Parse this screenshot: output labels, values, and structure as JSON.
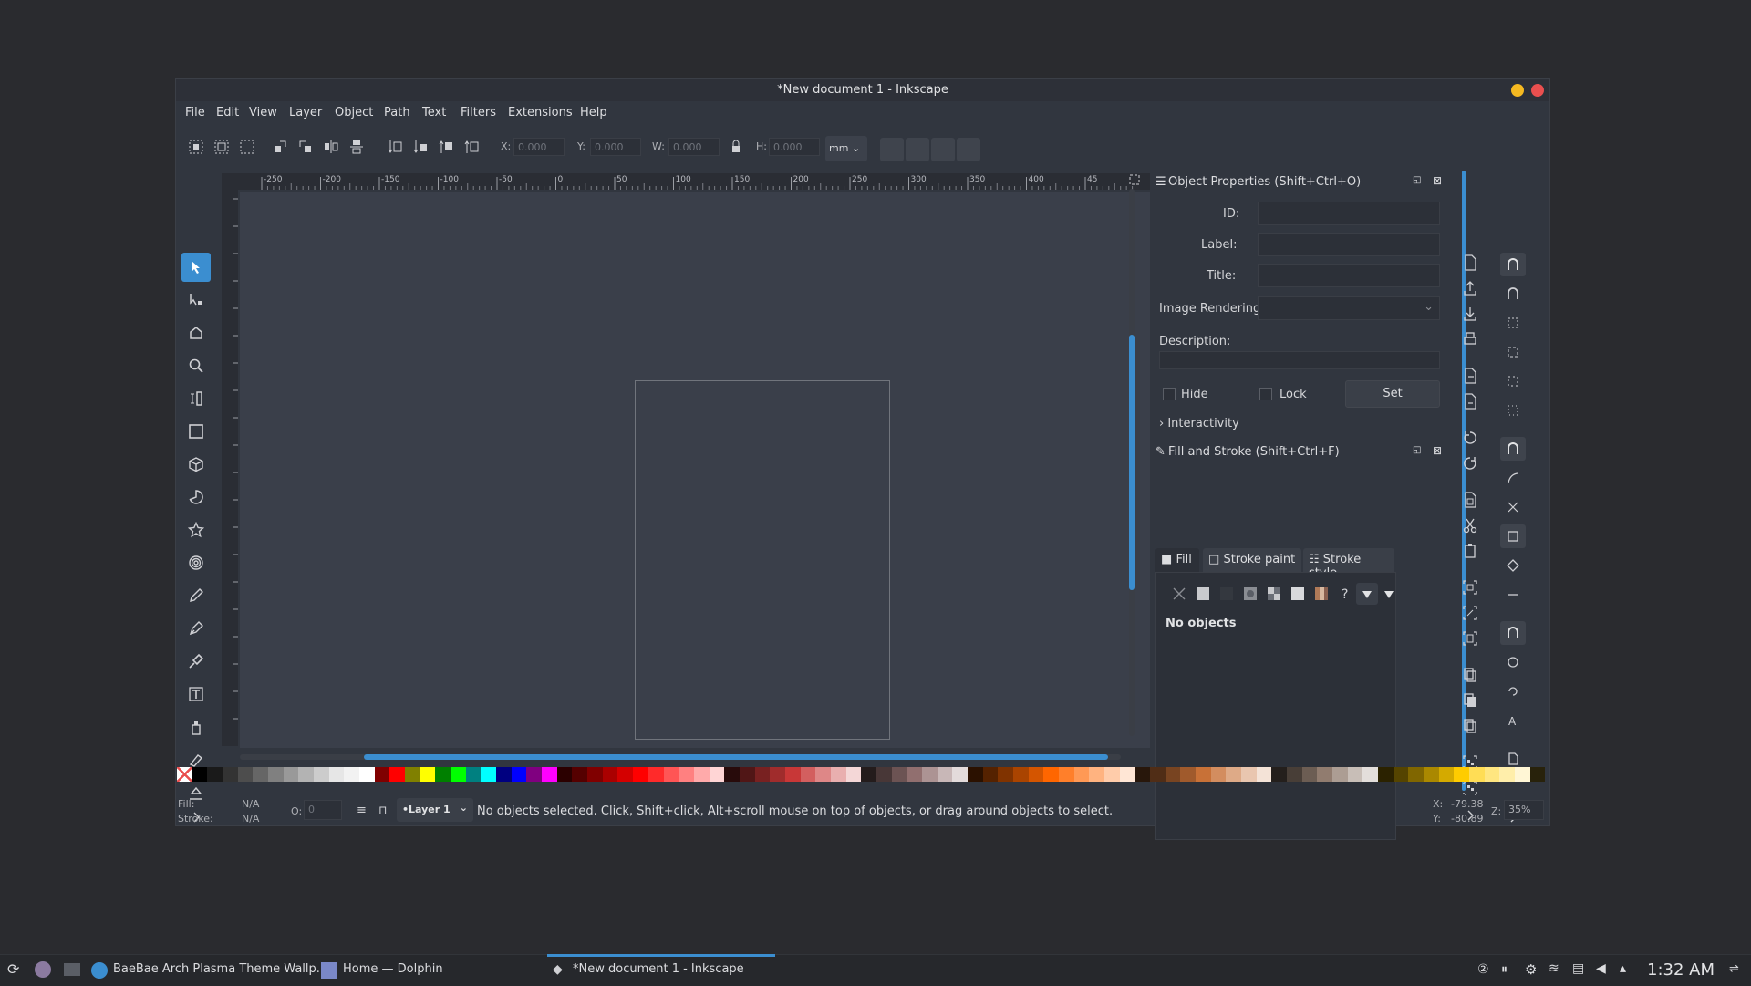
{
  "window": {
    "title": "*New document 1 - Inkscape"
  },
  "menu": [
    "File",
    "Edit",
    "View",
    "Layer",
    "Object",
    "Path",
    "Text",
    "Filters",
    "Extensions",
    "Help"
  ],
  "toolbar": {
    "x_label": "X:",
    "x_value": "0.000",
    "y_label": "Y:",
    "y_value": "0.000",
    "w_label": "W:",
    "w_value": "0.000",
    "h_label": "H:",
    "h_value": "0.000",
    "unit": "mm"
  },
  "ruler": {
    "h_ticks": [
      "-250",
      "-200",
      "-150",
      "-100",
      "-50",
      "0",
      "50",
      "100",
      "150",
      "200",
      "250",
      "300",
      "350",
      "400",
      "45"
    ]
  },
  "object_properties": {
    "title": "Object Properties (Shift+Ctrl+O)",
    "id_label": "ID:",
    "label_label": "Label:",
    "title_label": "Title:",
    "image_rendering_label": "Image Rendering:",
    "description_label": "Description:",
    "hide_label": "Hide",
    "lock_label": "Lock",
    "set_label": "Set",
    "interactivity_label": "Interactivity"
  },
  "fill_stroke": {
    "title": "Fill and Stroke (Shift+Ctrl+F)",
    "tabs": [
      "Fill",
      "Stroke paint",
      "Stroke style"
    ],
    "status": "No objects"
  },
  "status": {
    "fill_label": "Fill:",
    "fill_value": "N/A",
    "stroke_label": "Stroke:",
    "stroke_value": "N/A",
    "opacity_label": "O:",
    "opacity_value": "0",
    "layer": "•Layer 1",
    "message": "No objects selected. Click, Shift+click, Alt+scroll mouse on top of objects, or drag around objects to select.",
    "x_label": "X:",
    "x_value": "-79.38",
    "y_label": "Y:",
    "y_value": "-80.89",
    "zoom_label": "Z:",
    "zoom_value": "35%"
  },
  "taskbar": {
    "tasks": [
      "BaeBae Arch Plasma Theme Wallp...",
      "Home — Dolphin",
      "*New document 1 - Inkscape"
    ],
    "clock": "1:32 AM"
  },
  "colors": {
    "accent": "#3b8ed0",
    "window_bg": "#31363f",
    "canvas_bg": "#3a3f4a"
  }
}
